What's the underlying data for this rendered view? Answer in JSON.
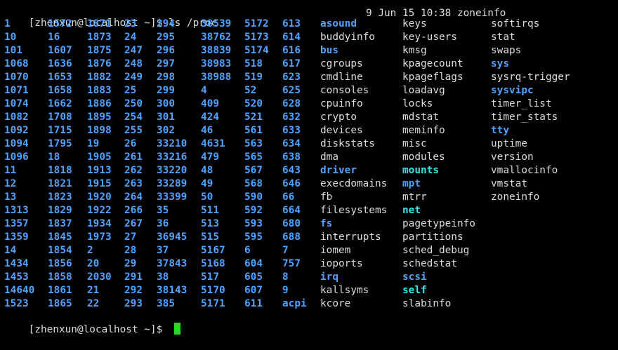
{
  "terminal": {
    "partial_top_line": "                                                                                                 ",
    "partial_top_right": "9 Jun 15 10:38 zoneinfo",
    "command_prompt": "[zhenxun@localhost ~]$ ls /proc",
    "final_prompt": "[zhenxun@localhost ~]$ ",
    "colors": {
      "background": "#000000",
      "text": "#dcdcdc",
      "directory": "#4fa3ff",
      "symlink": "#38e8e8",
      "cursor": "#22dd22"
    }
  },
  "listing": {
    "columns": [
      {
        "entries": [
          {
            "t": "1",
            "k": "dir"
          },
          {
            "t": "10",
            "k": "dir"
          },
          {
            "t": "101",
            "k": "dir"
          },
          {
            "t": "1068",
            "k": "dir"
          },
          {
            "t": "1070",
            "k": "dir"
          },
          {
            "t": "1071",
            "k": "dir"
          },
          {
            "t": "1074",
            "k": "dir"
          },
          {
            "t": "1082",
            "k": "dir"
          },
          {
            "t": "1092",
            "k": "dir"
          },
          {
            "t": "1094",
            "k": "dir"
          },
          {
            "t": "1096",
            "k": "dir"
          },
          {
            "t": "11",
            "k": "dir"
          },
          {
            "t": "12",
            "k": "dir"
          },
          {
            "t": "13",
            "k": "dir"
          },
          {
            "t": "1313",
            "k": "dir"
          },
          {
            "t": "1357",
            "k": "dir"
          },
          {
            "t": "1359",
            "k": "dir"
          },
          {
            "t": "14",
            "k": "dir"
          },
          {
            "t": "1434",
            "k": "dir"
          },
          {
            "t": "1453",
            "k": "dir"
          },
          {
            "t": "14640",
            "k": "dir"
          },
          {
            "t": "1523",
            "k": "dir"
          }
        ]
      },
      {
        "entries": [
          {
            "t": "1572",
            "k": "dir"
          },
          {
            "t": "16",
            "k": "dir"
          },
          {
            "t": "1607",
            "k": "dir"
          },
          {
            "t": "1636",
            "k": "dir"
          },
          {
            "t": "1653",
            "k": "dir"
          },
          {
            "t": "1658",
            "k": "dir"
          },
          {
            "t": "1662",
            "k": "dir"
          },
          {
            "t": "1708",
            "k": "dir"
          },
          {
            "t": "1715",
            "k": "dir"
          },
          {
            "t": "1795",
            "k": "dir"
          },
          {
            "t": "18",
            "k": "dir"
          },
          {
            "t": "1818",
            "k": "dir"
          },
          {
            "t": "1821",
            "k": "dir"
          },
          {
            "t": "1823",
            "k": "dir"
          },
          {
            "t": "1829",
            "k": "dir"
          },
          {
            "t": "1837",
            "k": "dir"
          },
          {
            "t": "1845",
            "k": "dir"
          },
          {
            "t": "1854",
            "k": "dir"
          },
          {
            "t": "1856",
            "k": "dir"
          },
          {
            "t": "1858",
            "k": "dir"
          },
          {
            "t": "1861",
            "k": "dir"
          },
          {
            "t": "1865",
            "k": "dir"
          }
        ]
      },
      {
        "entries": [
          {
            "t": "1871",
            "k": "dir"
          },
          {
            "t": "1873",
            "k": "dir"
          },
          {
            "t": "1875",
            "k": "dir"
          },
          {
            "t": "1876",
            "k": "dir"
          },
          {
            "t": "1882",
            "k": "dir"
          },
          {
            "t": "1883",
            "k": "dir"
          },
          {
            "t": "1886",
            "k": "dir"
          },
          {
            "t": "1895",
            "k": "dir"
          },
          {
            "t": "1898",
            "k": "dir"
          },
          {
            "t": "19",
            "k": "dir"
          },
          {
            "t": "1905",
            "k": "dir"
          },
          {
            "t": "1913",
            "k": "dir"
          },
          {
            "t": "1915",
            "k": "dir"
          },
          {
            "t": "1920",
            "k": "dir"
          },
          {
            "t": "1922",
            "k": "dir"
          },
          {
            "t": "1934",
            "k": "dir"
          },
          {
            "t": "1973",
            "k": "dir"
          },
          {
            "t": "2",
            "k": "dir"
          },
          {
            "t": "20",
            "k": "dir"
          },
          {
            "t": "2030",
            "k": "dir"
          },
          {
            "t": "21",
            "k": "dir"
          },
          {
            "t": "22",
            "k": "dir"
          }
        ]
      },
      {
        "entries": [
          {
            "t": "23",
            "k": "dir"
          },
          {
            "t": "24",
            "k": "dir"
          },
          {
            "t": "247",
            "k": "dir"
          },
          {
            "t": "248",
            "k": "dir"
          },
          {
            "t": "249",
            "k": "dir"
          },
          {
            "t": "25",
            "k": "dir"
          },
          {
            "t": "250",
            "k": "dir"
          },
          {
            "t": "254",
            "k": "dir"
          },
          {
            "t": "255",
            "k": "dir"
          },
          {
            "t": "26",
            "k": "dir"
          },
          {
            "t": "261",
            "k": "dir"
          },
          {
            "t": "262",
            "k": "dir"
          },
          {
            "t": "263",
            "k": "dir"
          },
          {
            "t": "264",
            "k": "dir"
          },
          {
            "t": "266",
            "k": "dir"
          },
          {
            "t": "267",
            "k": "dir"
          },
          {
            "t": "27",
            "k": "dir"
          },
          {
            "t": "28",
            "k": "dir"
          },
          {
            "t": "29",
            "k": "dir"
          },
          {
            "t": "291",
            "k": "dir"
          },
          {
            "t": "292",
            "k": "dir"
          },
          {
            "t": "293",
            "k": "dir"
          }
        ]
      },
      {
        "entries": [
          {
            "t": "294",
            "k": "dir"
          },
          {
            "t": "295",
            "k": "dir"
          },
          {
            "t": "296",
            "k": "dir"
          },
          {
            "t": "297",
            "k": "dir"
          },
          {
            "t": "298",
            "k": "dir"
          },
          {
            "t": "299",
            "k": "dir"
          },
          {
            "t": "300",
            "k": "dir"
          },
          {
            "t": "301",
            "k": "dir"
          },
          {
            "t": "302",
            "k": "dir"
          },
          {
            "t": "33210",
            "k": "dir"
          },
          {
            "t": "33216",
            "k": "dir"
          },
          {
            "t": "33220",
            "k": "dir"
          },
          {
            "t": "33289",
            "k": "dir"
          },
          {
            "t": "33399",
            "k": "dir"
          },
          {
            "t": "35",
            "k": "dir"
          },
          {
            "t": "36",
            "k": "dir"
          },
          {
            "t": "36945",
            "k": "dir"
          },
          {
            "t": "37",
            "k": "dir"
          },
          {
            "t": "37843",
            "k": "dir"
          },
          {
            "t": "38",
            "k": "dir"
          },
          {
            "t": "38143",
            "k": "dir"
          },
          {
            "t": "385",
            "k": "dir"
          }
        ]
      },
      {
        "entries": [
          {
            "t": "38539",
            "k": "dir"
          },
          {
            "t": "38762",
            "k": "dir"
          },
          {
            "t": "38839",
            "k": "dir"
          },
          {
            "t": "38983",
            "k": "dir"
          },
          {
            "t": "38988",
            "k": "dir"
          },
          {
            "t": "4",
            "k": "dir"
          },
          {
            "t": "409",
            "k": "dir"
          },
          {
            "t": "424",
            "k": "dir"
          },
          {
            "t": "46",
            "k": "dir"
          },
          {
            "t": "4631",
            "k": "dir"
          },
          {
            "t": "479",
            "k": "dir"
          },
          {
            "t": "48",
            "k": "dir"
          },
          {
            "t": "49",
            "k": "dir"
          },
          {
            "t": "50",
            "k": "dir"
          },
          {
            "t": "511",
            "k": "dir"
          },
          {
            "t": "513",
            "k": "dir"
          },
          {
            "t": "515",
            "k": "dir"
          },
          {
            "t": "5167",
            "k": "dir"
          },
          {
            "t": "5168",
            "k": "dir"
          },
          {
            "t": "517",
            "k": "dir"
          },
          {
            "t": "5170",
            "k": "dir"
          },
          {
            "t": "5171",
            "k": "dir"
          }
        ]
      },
      {
        "entries": [
          {
            "t": "5172",
            "k": "dir"
          },
          {
            "t": "5173",
            "k": "dir"
          },
          {
            "t": "5174",
            "k": "dir"
          },
          {
            "t": "518",
            "k": "dir"
          },
          {
            "t": "519",
            "k": "dir"
          },
          {
            "t": "52",
            "k": "dir"
          },
          {
            "t": "520",
            "k": "dir"
          },
          {
            "t": "521",
            "k": "dir"
          },
          {
            "t": "561",
            "k": "dir"
          },
          {
            "t": "563",
            "k": "dir"
          },
          {
            "t": "565",
            "k": "dir"
          },
          {
            "t": "567",
            "k": "dir"
          },
          {
            "t": "568",
            "k": "dir"
          },
          {
            "t": "590",
            "k": "dir"
          },
          {
            "t": "592",
            "k": "dir"
          },
          {
            "t": "593",
            "k": "dir"
          },
          {
            "t": "595",
            "k": "dir"
          },
          {
            "t": "6",
            "k": "dir"
          },
          {
            "t": "604",
            "k": "dir"
          },
          {
            "t": "605",
            "k": "dir"
          },
          {
            "t": "607",
            "k": "dir"
          },
          {
            "t": "611",
            "k": "dir"
          }
        ]
      },
      {
        "entries": [
          {
            "t": "613",
            "k": "dir"
          },
          {
            "t": "614",
            "k": "dir"
          },
          {
            "t": "616",
            "k": "dir"
          },
          {
            "t": "617",
            "k": "dir"
          },
          {
            "t": "623",
            "k": "dir"
          },
          {
            "t": "625",
            "k": "dir"
          },
          {
            "t": "628",
            "k": "dir"
          },
          {
            "t": "632",
            "k": "dir"
          },
          {
            "t": "633",
            "k": "dir"
          },
          {
            "t": "634",
            "k": "dir"
          },
          {
            "t": "638",
            "k": "dir"
          },
          {
            "t": "643",
            "k": "dir"
          },
          {
            "t": "646",
            "k": "dir"
          },
          {
            "t": "66",
            "k": "dir"
          },
          {
            "t": "664",
            "k": "dir"
          },
          {
            "t": "680",
            "k": "dir"
          },
          {
            "t": "688",
            "k": "dir"
          },
          {
            "t": "7",
            "k": "dir"
          },
          {
            "t": "757",
            "k": "dir"
          },
          {
            "t": "8",
            "k": "dir"
          },
          {
            "t": "9",
            "k": "dir"
          },
          {
            "t": "acpi",
            "k": "dir"
          }
        ]
      },
      {
        "entries": [
          {
            "t": "asound",
            "k": "dir"
          },
          {
            "t": "buddyinfo",
            "k": "file"
          },
          {
            "t": "bus",
            "k": "dir"
          },
          {
            "t": "cgroups",
            "k": "file"
          },
          {
            "t": "cmdline",
            "k": "file"
          },
          {
            "t": "consoles",
            "k": "file"
          },
          {
            "t": "cpuinfo",
            "k": "file"
          },
          {
            "t": "crypto",
            "k": "file"
          },
          {
            "t": "devices",
            "k": "file"
          },
          {
            "t": "diskstats",
            "k": "file"
          },
          {
            "t": "dma",
            "k": "file"
          },
          {
            "t": "driver",
            "k": "dir"
          },
          {
            "t": "execdomains",
            "k": "file"
          },
          {
            "t": "fb",
            "k": "file"
          },
          {
            "t": "filesystems",
            "k": "file"
          },
          {
            "t": "fs",
            "k": "dir"
          },
          {
            "t": "interrupts",
            "k": "file"
          },
          {
            "t": "iomem",
            "k": "file"
          },
          {
            "t": "ioports",
            "k": "file"
          },
          {
            "t": "irq",
            "k": "dir"
          },
          {
            "t": "kallsyms",
            "k": "file"
          },
          {
            "t": "kcore",
            "k": "file"
          }
        ]
      },
      {
        "entries": [
          {
            "t": "keys",
            "k": "file"
          },
          {
            "t": "key-users",
            "k": "file"
          },
          {
            "t": "kmsg",
            "k": "file"
          },
          {
            "t": "kpagecount",
            "k": "file"
          },
          {
            "t": "kpageflags",
            "k": "file"
          },
          {
            "t": "loadavg",
            "k": "file"
          },
          {
            "t": "locks",
            "k": "file"
          },
          {
            "t": "mdstat",
            "k": "file"
          },
          {
            "t": "meminfo",
            "k": "file"
          },
          {
            "t": "misc",
            "k": "file"
          },
          {
            "t": "modules",
            "k": "file"
          },
          {
            "t": "mounts",
            "k": "lnk"
          },
          {
            "t": "mpt",
            "k": "dir"
          },
          {
            "t": "mtrr",
            "k": "file"
          },
          {
            "t": "net",
            "k": "lnk"
          },
          {
            "t": "pagetypeinfo",
            "k": "file"
          },
          {
            "t": "partitions",
            "k": "file"
          },
          {
            "t": "sched_debug",
            "k": "file"
          },
          {
            "t": "schedstat",
            "k": "file"
          },
          {
            "t": "scsi",
            "k": "dir"
          },
          {
            "t": "self",
            "k": "lnk"
          },
          {
            "t": "slabinfo",
            "k": "file"
          }
        ]
      },
      {
        "entries": [
          {
            "t": "softirqs",
            "k": "file"
          },
          {
            "t": "stat",
            "k": "file"
          },
          {
            "t": "swaps",
            "k": "file"
          },
          {
            "t": "sys",
            "k": "dir"
          },
          {
            "t": "sysrq-trigger",
            "k": "file"
          },
          {
            "t": "sysvipc",
            "k": "dir"
          },
          {
            "t": "timer_list",
            "k": "file"
          },
          {
            "t": "timer_stats",
            "k": "file"
          },
          {
            "t": "tty",
            "k": "dir"
          },
          {
            "t": "uptime",
            "k": "file"
          },
          {
            "t": "version",
            "k": "file"
          },
          {
            "t": "vmallocinfo",
            "k": "file"
          },
          {
            "t": "vmstat",
            "k": "file"
          },
          {
            "t": "zoneinfo",
            "k": "file"
          }
        ]
      }
    ]
  }
}
